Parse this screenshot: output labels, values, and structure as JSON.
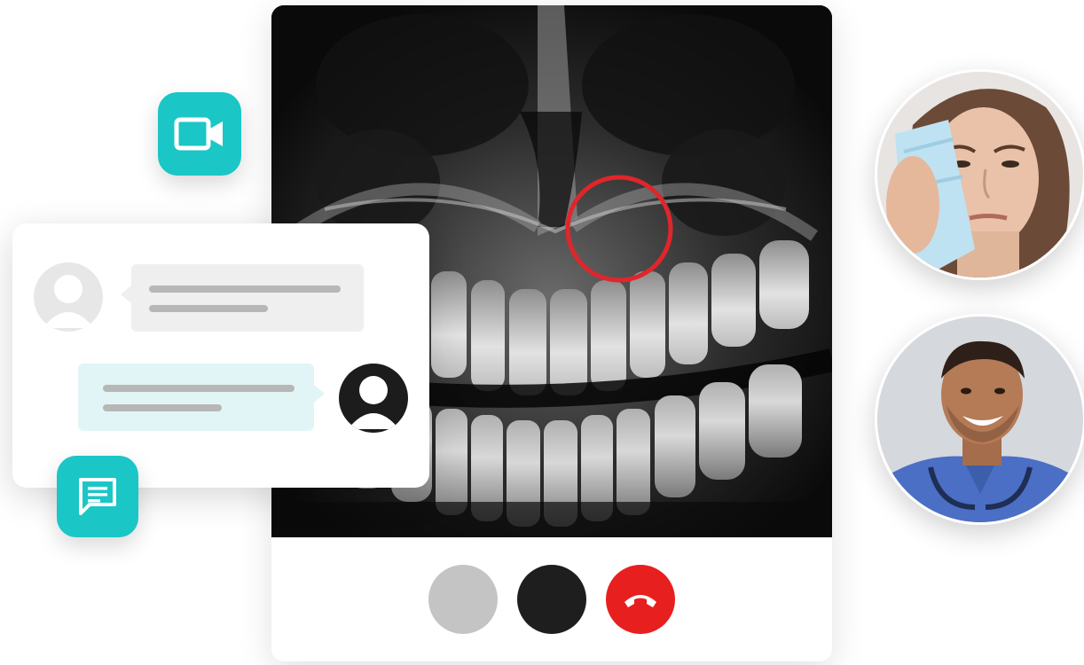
{
  "call": {
    "controls": {
      "mute_icon": "microphone-icon",
      "camera_icon": "camera-icon",
      "hangup_icon": "phone-hangup-icon",
      "hangup_color": "#e81f1f",
      "mute_color": "#c4c4c4",
      "camera_color": "#1e1e1e"
    },
    "annotation_color": "#e0262b"
  },
  "tiles": {
    "video_icon": "video-camera-icon",
    "chat_icon": "chat-message-icon",
    "accent_color": "#1bc6c6"
  },
  "chat": {
    "incoming_bubble_color": "#efefef",
    "outgoing_bubble_color": "#e2f5f6",
    "avatar_icon": "user-avatar-icon"
  },
  "participants": [
    {
      "role": "patient",
      "icon": "patient-photo"
    },
    {
      "role": "doctor",
      "icon": "doctor-photo"
    }
  ]
}
